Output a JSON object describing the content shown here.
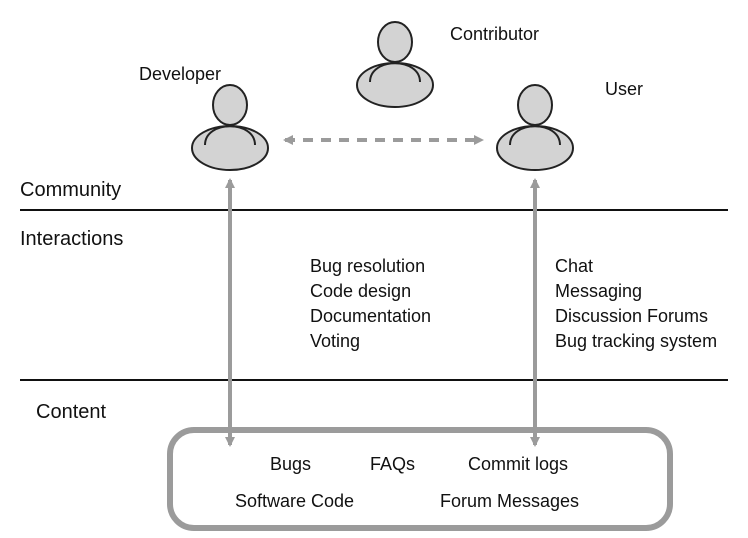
{
  "section_labels": {
    "community": "Community",
    "interactions": "Interactions",
    "content": "Content"
  },
  "roles": {
    "developer": "Developer",
    "contributor": "Contributor",
    "user": "User"
  },
  "interactions_left": [
    "Bug resolution",
    "Code design",
    "Documentation",
    "Voting"
  ],
  "interactions_right": [
    "Chat",
    "Messaging",
    "Discussion Forums",
    "Bug tracking system"
  ],
  "content_top": [
    "Bugs",
    "FAQs",
    "Commit logs"
  ],
  "content_bottom": [
    "Software Code",
    "Forum Messages"
  ]
}
